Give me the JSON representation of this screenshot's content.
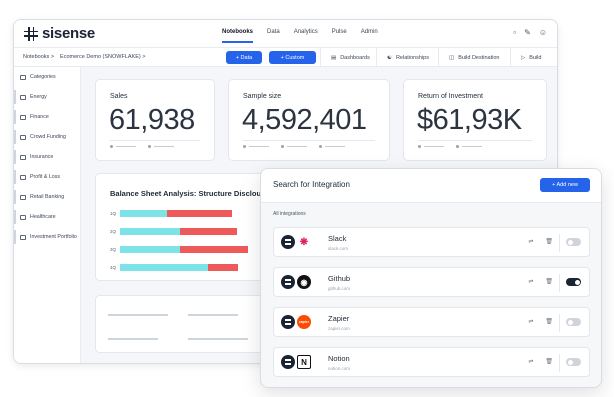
{
  "app": {
    "brand": "sisense",
    "nav": [
      "Notebooks",
      "Data",
      "Analytics",
      "Pulse",
      "Admin"
    ],
    "active_nav": "Notebooks",
    "top_icons": [
      "chat-icon",
      "pen-icon",
      "user-icon"
    ]
  },
  "subbar": {
    "breadcrumb_root": "Notebooks",
    "breadcrumb_current": "Ecomerce Demo (SNOWFLAKE)",
    "data_button": "+ Data",
    "custom_button": "+ Custom",
    "tools": [
      "Dashboards",
      "Relationships",
      "Build Destination",
      "Build"
    ]
  },
  "sidebar": {
    "header": "Categories",
    "items": [
      "Energy",
      "Finance",
      "Crowd Funding",
      "Insurance",
      "Profit & Loss",
      "Retail Banking",
      "Healthcare",
      "Investment Portfolio"
    ]
  },
  "metrics": [
    {
      "label": "Sales",
      "value": "61,938"
    },
    {
      "label": "Sample size",
      "value": "4,592,401"
    },
    {
      "label": "Return of Investment",
      "value": "$61,93K"
    }
  ],
  "balance_chart": {
    "title": "Balance Sheet Analysis: Structure Disclousure",
    "colors": {
      "a": "#7ee3e6",
      "b": "#ee5a5a"
    }
  },
  "chart_data": {
    "type": "bar",
    "title": "Balance Sheet Analysis: Structure Disclousure",
    "categories": [
      "1Q",
      "2Q",
      "3Q",
      "4Q"
    ],
    "series": [
      {
        "values": [
          47,
          60,
          60,
          88
        ]
      },
      {
        "values": [
          65,
          57,
          68,
          30
        ]
      }
    ],
    "orientation": "horizontal",
    "stacked": true
  },
  "panel": {
    "title": "Search for Integration",
    "add_button": "+ Add new",
    "section": "All integrations",
    "integrations": [
      {
        "name": "Slack",
        "domain": "slack.com",
        "enabled": false
      },
      {
        "name": "Github",
        "domain": "github.com",
        "enabled": true
      },
      {
        "name": "Zapier",
        "domain": "zapier.com",
        "enabled": false
      },
      {
        "name": "Notion",
        "domain": "notion.com",
        "enabled": false
      }
    ]
  }
}
